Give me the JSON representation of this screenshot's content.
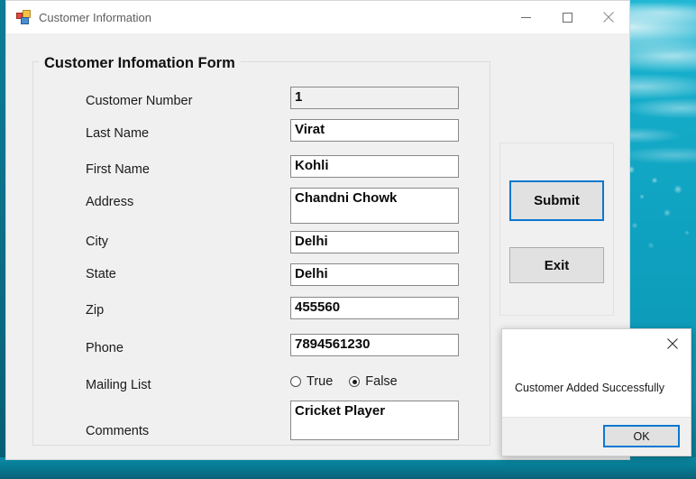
{
  "window": {
    "title": "Customer Information",
    "icon": "winforms-icon",
    "controls": {
      "minimize": "minimize-icon",
      "maximize": "maximize-icon",
      "close": "close-icon"
    }
  },
  "form": {
    "legend": "Customer Infomation Form",
    "fields": [
      {
        "label": "Customer Number",
        "value": "1",
        "readonly": true,
        "name": "customer-number"
      },
      {
        "label": "Last Name",
        "value": "Virat",
        "readonly": false,
        "name": "last-name"
      },
      {
        "label": "First Name",
        "value": "Kohli",
        "readonly": false,
        "name": "first-name"
      },
      {
        "label": "Address",
        "value": "Chandni Chowk",
        "readonly": false,
        "name": "address"
      },
      {
        "label": "City",
        "value": "Delhi",
        "readonly": false,
        "name": "city"
      },
      {
        "label": "State",
        "value": "Delhi",
        "readonly": false,
        "name": "state"
      },
      {
        "label": "Zip",
        "value": "455560",
        "readonly": false,
        "name": "zip"
      },
      {
        "label": "Phone",
        "value": "7894561230",
        "readonly": false,
        "name": "phone"
      },
      {
        "label": "Comments",
        "value": "Cricket Player",
        "readonly": false,
        "name": "comments"
      }
    ],
    "mailing_list": {
      "label": "Mailing List",
      "options": [
        {
          "label": "True",
          "selected": false
        },
        {
          "label": "False",
          "selected": true
        }
      ]
    }
  },
  "buttons": {
    "submit": "Submit",
    "exit": "Exit"
  },
  "dialog": {
    "message": "Customer Added Successfully",
    "ok": "OK",
    "close_icon": "close-icon"
  },
  "colors": {
    "accent_focus": "#0b78d0",
    "window_chrome": "#f0f0f0",
    "desktop": "#10a6c4"
  }
}
